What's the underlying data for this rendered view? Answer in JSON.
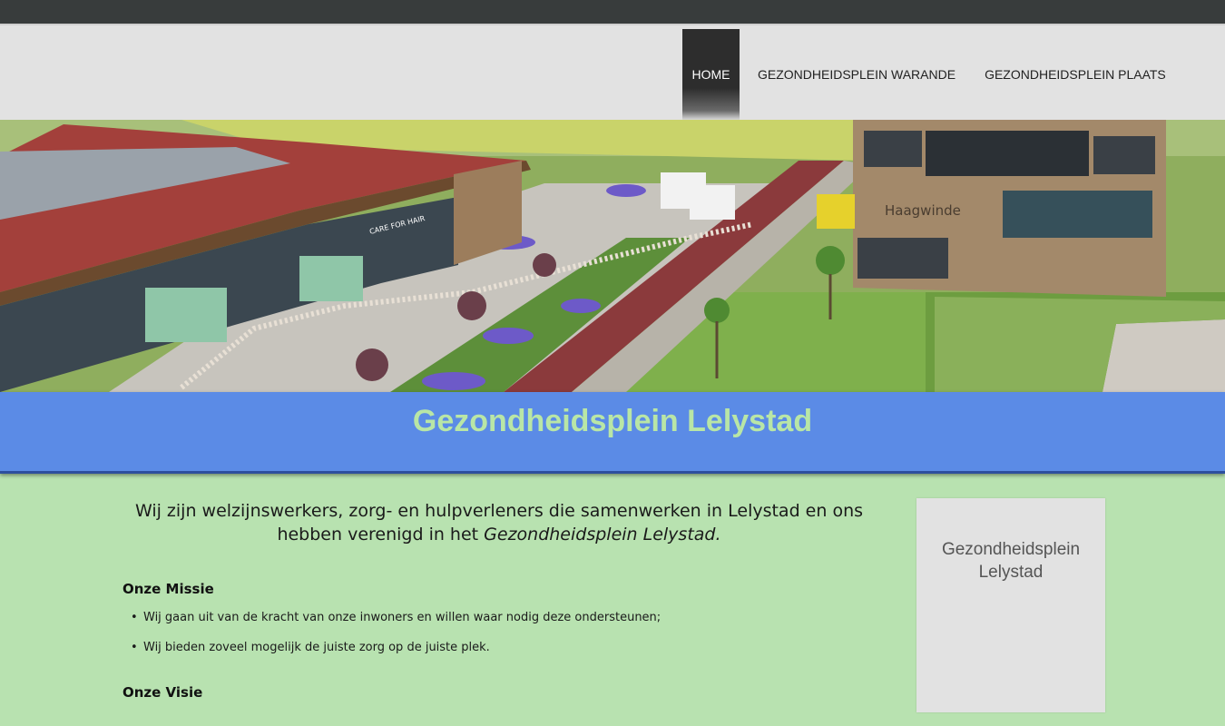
{
  "nav": {
    "items": [
      {
        "label": "HOME",
        "active": true
      },
      {
        "label": "GEZONDHEIDSPLEIN WARANDE",
        "active": false
      },
      {
        "label": "GEZONDHEIDSPLEIN PLAATS",
        "active": false
      }
    ]
  },
  "hero": {
    "building_sign": "Haagwinde",
    "shop_sign": "CARE FOR HAIR"
  },
  "banner": {
    "title": "Gezondheidsplein Lelystad"
  },
  "main": {
    "intro_text": "Wij zijn welzijnswerkers, zorg- en hulpverleners die samenwerken in Lelystad en ons hebben verenigd in het ",
    "intro_emphasis": "Gezondheidsplein Lelystad.",
    "mission_title": "Onze Missie",
    "mission_items": [
      "Wij gaan uit van de kracht van onze inwoners en willen waar nodig deze ondersteunen;",
      "Wij bieden zoveel mogelijk de juiste zorg op de juiste plek."
    ],
    "vision_title": "Onze Visie"
  },
  "sidebar": {
    "line1": "Gezondheidsplein",
    "line2": "Lelystad"
  },
  "colors": {
    "topbar": "#383c3c",
    "header": "#e2e2e2",
    "banner": "#5b8be6",
    "banner_text": "#b9e6a6",
    "page_bg": "#b8e2b0"
  }
}
